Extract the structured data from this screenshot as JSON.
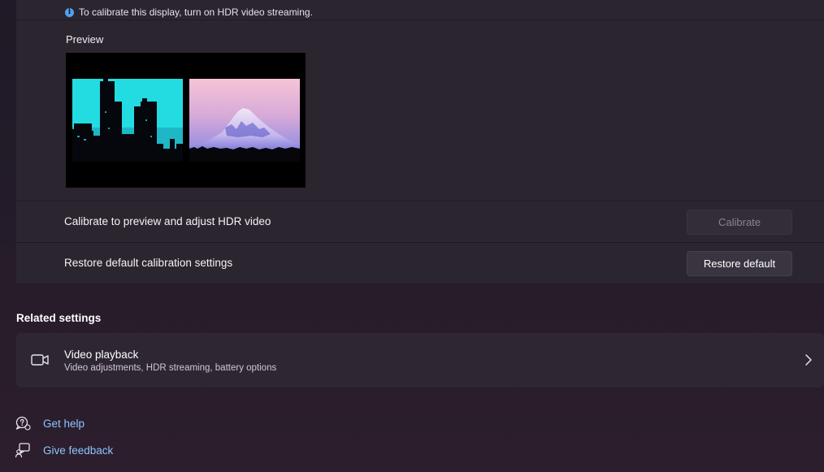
{
  "info": {
    "icon": "info-icon",
    "glyph": "i",
    "text": "To calibrate this display, turn on HDR video streaming."
  },
  "preview": {
    "label": "Preview"
  },
  "calibrate_row": {
    "label": "Calibrate to preview and adjust HDR video",
    "button": "Calibrate",
    "button_enabled": false
  },
  "restore_row": {
    "label": "Restore default calibration settings",
    "button": "Restore default"
  },
  "related": {
    "title": "Related settings",
    "video_playback": {
      "icon": "video-camera-icon",
      "title": "Video playback",
      "subtitle": "Video adjustments, HDR streaming, battery options",
      "chevron": "chevron-right-icon"
    }
  },
  "links": {
    "help": {
      "icon": "help-chat-icon",
      "label": "Get help"
    },
    "feedback": {
      "icon": "feedback-icon",
      "label": "Give feedback"
    }
  },
  "colors": {
    "accent_link": "#8cc6ff",
    "info_icon": "#4ea3f1",
    "card_bg": "#2b2530"
  }
}
